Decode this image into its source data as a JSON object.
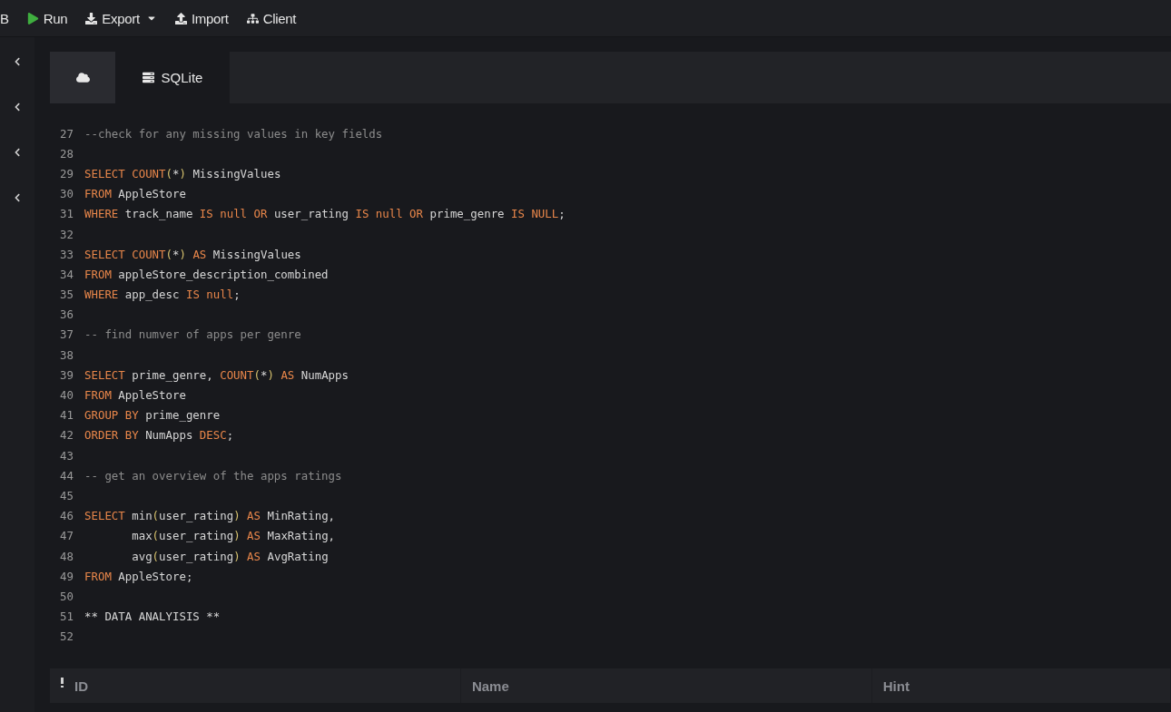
{
  "toolbar": [
    {
      "label": "B",
      "kind": "text"
    },
    {
      "label": "Run",
      "kind": "run"
    },
    {
      "label": "Export",
      "kind": "export"
    },
    {
      "label": "Import",
      "kind": "import"
    },
    {
      "label": "Client",
      "kind": "client"
    }
  ],
  "tabs": [
    {
      "kind": "cloud",
      "selected": false
    },
    {
      "kind": "database",
      "label": "SQLite",
      "selected": true
    }
  ],
  "editor": {
    "lines": [
      {
        "n": "27",
        "tokens": [
          {
            "kind": "comment",
            "t": "--check for any missing values in key fields"
          }
        ]
      },
      {
        "n": "28"
      },
      {
        "n": "29",
        "tokens": [
          {
            "kind": "kw",
            "t": "SELECT COUNT"
          },
          {
            "kind": "paren",
            "t": "("
          },
          {
            "kind": "plain",
            "t": "*"
          },
          {
            "kind": "paren",
            "t": ")"
          },
          {
            "kind": "plain",
            "t": " MissingValues"
          }
        ]
      },
      {
        "n": "30",
        "tokens": [
          {
            "kind": "kw",
            "t": "FROM"
          },
          {
            "kind": "plain",
            "t": " AppleStore"
          }
        ]
      },
      {
        "n": "31",
        "tokens": [
          {
            "kind": "kw",
            "t": "WHERE"
          },
          {
            "kind": "plain",
            "t": " track_name "
          },
          {
            "kind": "kw",
            "t": "IS null OR"
          },
          {
            "kind": "plain",
            "t": " user_rating "
          },
          {
            "kind": "kw",
            "t": "IS null OR"
          },
          {
            "kind": "plain",
            "t": " prime_genre "
          },
          {
            "kind": "kw",
            "t": "IS NULL"
          },
          {
            "kind": "plain",
            "t": ";"
          }
        ]
      },
      {
        "n": "32"
      },
      {
        "n": "33",
        "tokens": [
          {
            "kind": "kw",
            "t": "SELECT COUNT"
          },
          {
            "kind": "paren",
            "t": "("
          },
          {
            "kind": "plain",
            "t": "*"
          },
          {
            "kind": "paren",
            "t": ")"
          },
          {
            "kind": "kw",
            "t": " AS"
          },
          {
            "kind": "plain",
            "t": " MissingValues"
          }
        ]
      },
      {
        "n": "34",
        "tokens": [
          {
            "kind": "kw",
            "t": "FROM"
          },
          {
            "kind": "plain",
            "t": " appleStore_description_combined"
          }
        ]
      },
      {
        "n": "35",
        "tokens": [
          {
            "kind": "kw",
            "t": "WHERE"
          },
          {
            "kind": "plain",
            "t": " app_desc "
          },
          {
            "kind": "kw",
            "t": "IS null"
          },
          {
            "kind": "plain",
            "t": ";"
          }
        ]
      },
      {
        "n": "36"
      },
      {
        "n": "37",
        "tokens": [
          {
            "kind": "comment",
            "t": "-- find numver of apps per genre"
          }
        ]
      },
      {
        "n": "38"
      },
      {
        "n": "39",
        "tokens": [
          {
            "kind": "kw",
            "t": "SELECT"
          },
          {
            "kind": "plain",
            "t": " prime_genre, "
          },
          {
            "kind": "kw",
            "t": "COUNT"
          },
          {
            "kind": "paren",
            "t": "("
          },
          {
            "kind": "plain",
            "t": "*"
          },
          {
            "kind": "paren",
            "t": ")"
          },
          {
            "kind": "kw",
            "t": " AS"
          },
          {
            "kind": "plain",
            "t": " NumApps"
          }
        ]
      },
      {
        "n": "40",
        "tokens": [
          {
            "kind": "kw",
            "t": "FROM"
          },
          {
            "kind": "plain",
            "t": " AppleStore"
          }
        ]
      },
      {
        "n": "41",
        "tokens": [
          {
            "kind": "kw",
            "t": "GROUP BY"
          },
          {
            "kind": "plain",
            "t": " prime_genre"
          }
        ]
      },
      {
        "n": "42",
        "tokens": [
          {
            "kind": "kw",
            "t": "ORDER BY"
          },
          {
            "kind": "plain",
            "t": " NumApps "
          },
          {
            "kind": "kw",
            "t": "DESC"
          },
          {
            "kind": "plain",
            "t": ";"
          }
        ]
      },
      {
        "n": "43"
      },
      {
        "n": "44",
        "tokens": [
          {
            "kind": "comment",
            "t": "-- get an overview of the apps ratings"
          }
        ]
      },
      {
        "n": "45"
      },
      {
        "n": "46",
        "tokens": [
          {
            "kind": "kw",
            "t": "SELECT"
          },
          {
            "kind": "plain",
            "t": " min"
          },
          {
            "kind": "paren",
            "t": "("
          },
          {
            "kind": "plain",
            "t": "user_rating"
          },
          {
            "kind": "paren",
            "t": ")"
          },
          {
            "kind": "kw",
            "t": " AS"
          },
          {
            "kind": "plain",
            "t": " MinRating,"
          }
        ]
      },
      {
        "n": "47",
        "tokens": [
          {
            "kind": "plain",
            "t": "       max"
          },
          {
            "kind": "paren",
            "t": "("
          },
          {
            "kind": "plain",
            "t": "user_rating"
          },
          {
            "kind": "paren",
            "t": ")"
          },
          {
            "kind": "kw",
            "t": " AS"
          },
          {
            "kind": "plain",
            "t": " MaxRating,"
          }
        ]
      },
      {
        "n": "48",
        "tokens": [
          {
            "kind": "plain",
            "t": "       avg"
          },
          {
            "kind": "paren",
            "t": "("
          },
          {
            "kind": "plain",
            "t": "user_rating"
          },
          {
            "kind": "paren",
            "t": ")"
          },
          {
            "kind": "kw",
            "t": " AS"
          },
          {
            "kind": "plain",
            "t": " AvgRating"
          }
        ]
      },
      {
        "n": "49",
        "tokens": [
          {
            "kind": "kw",
            "t": "FROM"
          },
          {
            "kind": "plain",
            "t": " AppleStore;"
          }
        ]
      },
      {
        "n": "50"
      },
      {
        "n": "51",
        "tokens": [
          {
            "kind": "plain",
            "t": "** DATA ANALYISIS **"
          }
        ]
      },
      {
        "n": "52"
      }
    ]
  },
  "results": {
    "columns": [
      "ID",
      "Name",
      "Hint"
    ]
  }
}
